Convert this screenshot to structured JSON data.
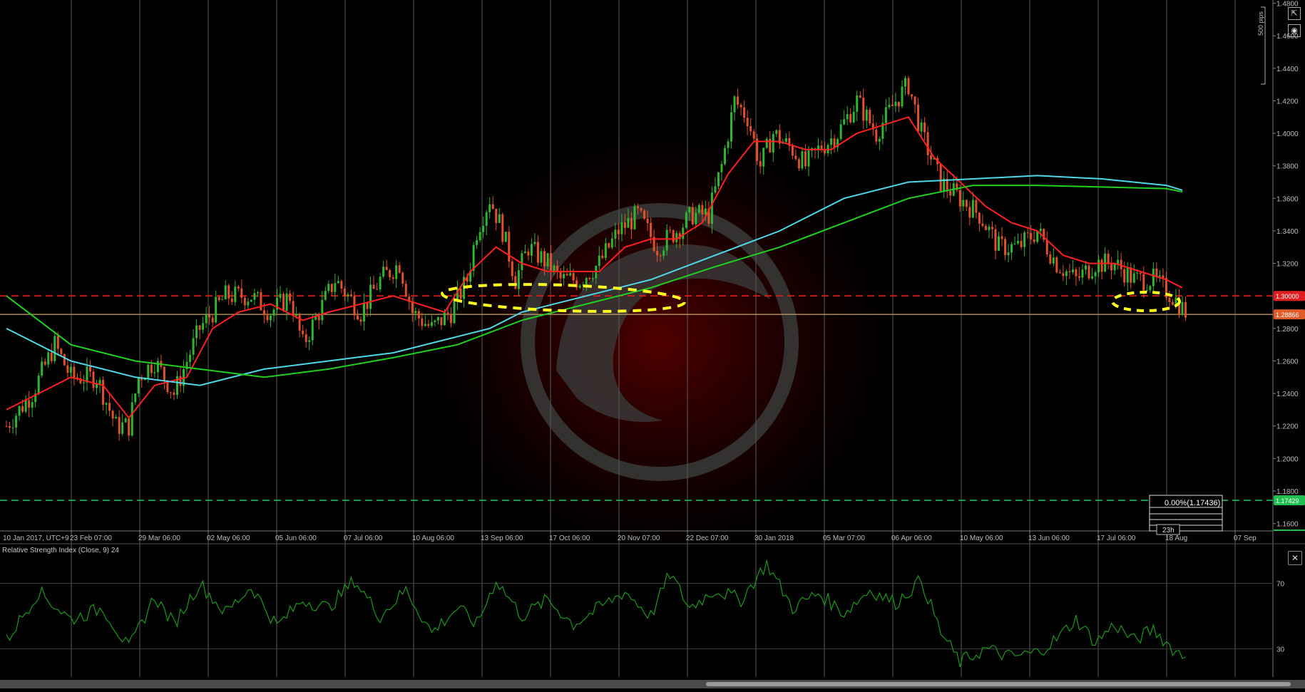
{
  "chart_data": {
    "type": "candlestick",
    "y_axis": {
      "ticks": [
        "1.4800",
        "1.4600",
        "1.4400",
        "1.4200",
        "1.4000",
        "1.3800",
        "1.3600",
        "1.3400",
        "1.3200",
        "1.2800",
        "1.2600",
        "1.2400",
        "1.2200",
        "1.2000",
        "1.1800",
        "1.1600"
      ],
      "range": [
        1.148,
        1.482
      ]
    },
    "x_axis": {
      "ticks": [
        "10 Jan 2017, UTC+9",
        "23 Feb 07:00",
        "29 Mar 06:00",
        "02 May 06:00",
        "05 Jun 06:00",
        "07 Jul 06:00",
        "10 Aug 06:00",
        "13 Sep 06:00",
        "17 Oct 06:00",
        "20 Nov 07:00",
        "22 Dec 07:00",
        "30 Jan 2018",
        "05 Mar 07:00",
        "06 Apr 06:00",
        "10 May 06:00",
        "13 Jun 06:00",
        "17 Jul 06:00",
        "18 Aug",
        "07 Sep"
      ]
    },
    "price_levels": [
      {
        "label": "1.30000",
        "value": 1.3,
        "color": "#e02020",
        "style": "dashed"
      },
      {
        "label": "1.28866",
        "value": 1.28866,
        "color": "#c8a46a",
        "style": "solid",
        "badge_color": "#e05a2a"
      },
      {
        "label": "1.17429",
        "value": 1.17429,
        "color": "#20c050",
        "style": "dashed"
      }
    ],
    "fibonacci": {
      "label": "0.00%(1.17436)",
      "time_label": "23h"
    },
    "pips_label": "500 pips",
    "price_path": [
      [
        0,
        1.22
      ],
      [
        8,
        1.24
      ],
      [
        15,
        1.27
      ],
      [
        20,
        1.25
      ],
      [
        28,
        1.25
      ],
      [
        34,
        1.22
      ],
      [
        38,
        1.22
      ],
      [
        41,
        1.25
      ],
      [
        46,
        1.26
      ],
      [
        52,
        1.24
      ],
      [
        56,
        1.26
      ],
      [
        60,
        1.28
      ],
      [
        68,
        1.3
      ],
      [
        76,
        1.3
      ],
      [
        82,
        1.29
      ],
      [
        88,
        1.3
      ],
      [
        92,
        1.27
      ],
      [
        97,
        1.29
      ],
      [
        102,
        1.31
      ],
      [
        110,
        1.29
      ],
      [
        116,
        1.31
      ],
      [
        122,
        1.32
      ],
      [
        126,
        1.29
      ],
      [
        132,
        1.28
      ],
      [
        138,
        1.29
      ],
      [
        143,
        1.31
      ],
      [
        146,
        1.34
      ],
      [
        150,
        1.36
      ],
      [
        154,
        1.34
      ],
      [
        158,
        1.31
      ],
      [
        162,
        1.33
      ],
      [
        168,
        1.32
      ],
      [
        172,
        1.31
      ],
      [
        178,
        1.31
      ],
      [
        184,
        1.32
      ],
      [
        190,
        1.34
      ],
      [
        196,
        1.35
      ],
      [
        202,
        1.33
      ],
      [
        208,
        1.34
      ],
      [
        213,
        1.35
      ],
      [
        218,
        1.35
      ],
      [
        222,
        1.38
      ],
      [
        226,
        1.42
      ],
      [
        230,
        1.41
      ],
      [
        234,
        1.38
      ],
      [
        238,
        1.4
      ],
      [
        244,
        1.39
      ],
      [
        248,
        1.38
      ],
      [
        252,
        1.39
      ],
      [
        258,
        1.4
      ],
      [
        264,
        1.42
      ],
      [
        270,
        1.4
      ],
      [
        276,
        1.42
      ],
      [
        280,
        1.43
      ],
      [
        284,
        1.4
      ],
      [
        290,
        1.37
      ],
      [
        296,
        1.36
      ],
      [
        302,
        1.35
      ],
      [
        308,
        1.33
      ],
      [
        314,
        1.33
      ],
      [
        320,
        1.34
      ],
      [
        326,
        1.32
      ],
      [
        332,
        1.31
      ],
      [
        338,
        1.32
      ],
      [
        344,
        1.32
      ],
      [
        350,
        1.31
      ],
      [
        356,
        1.31
      ],
      [
        362,
        1.3
      ],
      [
        366,
        1.29
      ]
    ],
    "series": [
      {
        "name": "",
        "color": "#ff2020",
        "values": [
          [
            0,
            1.23
          ],
          [
            10,
            1.24
          ],
          [
            20,
            1.25
          ],
          [
            30,
            1.245
          ],
          [
            38,
            1.225
          ],
          [
            46,
            1.245
          ],
          [
            56,
            1.25
          ],
          [
            64,
            1.28
          ],
          [
            72,
            1.29
          ],
          [
            82,
            1.295
          ],
          [
            92,
            1.285
          ],
          [
            100,
            1.29
          ],
          [
            110,
            1.295
          ],
          [
            120,
            1.3
          ],
          [
            128,
            1.295
          ],
          [
            136,
            1.29
          ],
          [
            144,
            1.315
          ],
          [
            152,
            1.33
          ],
          [
            160,
            1.32
          ],
          [
            168,
            1.315
          ],
          [
            176,
            1.315
          ],
          [
            184,
            1.315
          ],
          [
            192,
            1.33
          ],
          [
            200,
            1.335
          ],
          [
            208,
            1.335
          ],
          [
            216,
            1.345
          ],
          [
            224,
            1.375
          ],
          [
            232,
            1.395
          ],
          [
            240,
            1.395
          ],
          [
            248,
            1.39
          ],
          [
            256,
            1.39
          ],
          [
            264,
            1.4
          ],
          [
            272,
            1.405
          ],
          [
            280,
            1.41
          ],
          [
            288,
            1.385
          ],
          [
            296,
            1.37
          ],
          [
            304,
            1.355
          ],
          [
            312,
            1.345
          ],
          [
            320,
            1.34
          ],
          [
            328,
            1.325
          ],
          [
            336,
            1.32
          ],
          [
            344,
            1.32
          ],
          [
            352,
            1.315
          ],
          [
            360,
            1.31
          ],
          [
            365,
            1.305
          ]
        ]
      },
      {
        "name": "",
        "color": "#4fd8e8",
        "values": [
          [
            0,
            1.28
          ],
          [
            20,
            1.26
          ],
          [
            40,
            1.25
          ],
          [
            60,
            1.245
          ],
          [
            80,
            1.255
          ],
          [
            100,
            1.26
          ],
          [
            120,
            1.265
          ],
          [
            140,
            1.275
          ],
          [
            150,
            1.28
          ],
          [
            160,
            1.29
          ],
          [
            180,
            1.3
          ],
          [
            200,
            1.31
          ],
          [
            220,
            1.325
          ],
          [
            240,
            1.34
          ],
          [
            260,
            1.36
          ],
          [
            280,
            1.37
          ],
          [
            300,
            1.372
          ],
          [
            320,
            1.374
          ],
          [
            340,
            1.372
          ],
          [
            360,
            1.368
          ],
          [
            365,
            1.365
          ]
        ]
      },
      {
        "name": "",
        "color": "#20d020",
        "values": [
          [
            0,
            1.3
          ],
          [
            20,
            1.27
          ],
          [
            40,
            1.26
          ],
          [
            60,
            1.255
          ],
          [
            80,
            1.25
          ],
          [
            100,
            1.255
          ],
          [
            120,
            1.262
          ],
          [
            140,
            1.27
          ],
          [
            160,
            1.285
          ],
          [
            180,
            1.295
          ],
          [
            200,
            1.305
          ],
          [
            220,
            1.318
          ],
          [
            240,
            1.33
          ],
          [
            260,
            1.345
          ],
          [
            280,
            1.36
          ],
          [
            300,
            1.368
          ],
          [
            320,
            1.368
          ],
          [
            340,
            1.367
          ],
          [
            360,
            1.366
          ],
          [
            365,
            1.364
          ]
        ]
      }
    ],
    "rsi": {
      "title": "Relative Strength Index (Close, 9) 24",
      "ticks": [
        "70",
        "30"
      ],
      "range": [
        15,
        85
      ],
      "color": "#1a9a1a",
      "values": [
        [
          0,
          35
        ],
        [
          10,
          65
        ],
        [
          20,
          48
        ],
        [
          30,
          55
        ],
        [
          38,
          30
        ],
        [
          46,
          62
        ],
        [
          52,
          45
        ],
        [
          60,
          70
        ],
        [
          68,
          52
        ],
        [
          76,
          68
        ],
        [
          84,
          44
        ],
        [
          92,
          60
        ],
        [
          100,
          55
        ],
        [
          108,
          72
        ],
        [
          116,
          50
        ],
        [
          124,
          66
        ],
        [
          132,
          40
        ],
        [
          140,
          55
        ],
        [
          146,
          45
        ],
        [
          152,
          72
        ],
        [
          160,
          50
        ],
        [
          168,
          60
        ],
        [
          176,
          45
        ],
        [
          184,
          55
        ],
        [
          192,
          65
        ],
        [
          200,
          50
        ],
        [
          206,
          76
        ],
        [
          212,
          55
        ],
        [
          220,
          66
        ],
        [
          228,
          60
        ],
        [
          236,
          82
        ],
        [
          244,
          55
        ],
        [
          252,
          64
        ],
        [
          260,
          52
        ],
        [
          268,
          66
        ],
        [
          276,
          58
        ],
        [
          284,
          72
        ],
        [
          290,
          40
        ],
        [
          296,
          22
        ],
        [
          304,
          30
        ],
        [
          312,
          25
        ],
        [
          320,
          28
        ],
        [
          326,
          36
        ],
        [
          332,
          48
        ],
        [
          338,
          34
        ],
        [
          344,
          45
        ],
        [
          350,
          35
        ],
        [
          356,
          42
        ],
        [
          362,
          30
        ],
        [
          366,
          25
        ]
      ]
    },
    "annotations": [
      "yellow dashed ellipse Aug–Nov 2017 near 1.3000",
      "yellow dashed ellipse Jul 2018 near 1.3000"
    ],
    "grid": "vertical lines only"
  },
  "ui": {
    "rsi_close_icon": "close-icon",
    "expand_icon": "expand-icon",
    "camera_icon": "camera-icon"
  }
}
